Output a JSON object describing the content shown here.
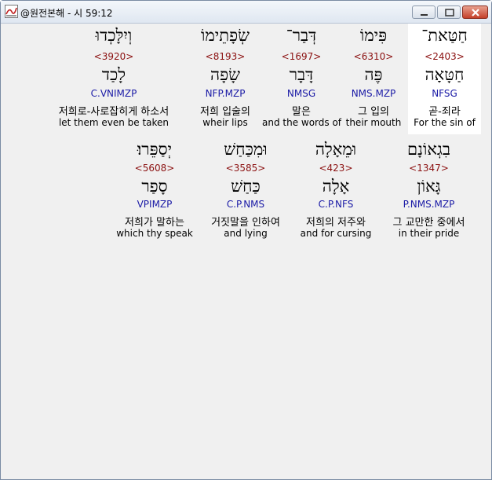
{
  "window": {
    "title": "@원전본해 - 시 59:12",
    "controls": {
      "minimize": "minimize",
      "maximize": "maximize",
      "close": "close"
    }
  },
  "rows": [
    {
      "words": [
        {
          "hebrew": "חַטַּאת־",
          "strong": "<2403>",
          "lemma": "חַטָּאָה",
          "parse": "NFSG",
          "korean": "곧-죄라",
          "english": "For the sin of",
          "selected": true
        },
        {
          "hebrew": "פִּימוֹ",
          "strong": "<6310>",
          "lemma": "פֶּה",
          "parse": "NMS.MZP",
          "korean": "그 입의",
          "english": "their mouth"
        },
        {
          "hebrew": "דְּבַר־",
          "strong": "<1697>",
          "lemma": "דָּבָר",
          "parse": "NMSG",
          "korean": "말은",
          "english": "and the words of"
        },
        {
          "hebrew": "שְׂפָתֵימוֹ",
          "strong": "<8193>",
          "lemma": "שָׂפָה",
          "parse": "NFP.MZP",
          "korean": "저희 입술의",
          "english": "wheir lips"
        },
        {
          "hebrew": "וְיִלָּכְדוּ",
          "strong": "<3920>",
          "lemma": "לָכַד",
          "parse": "C.VNIMZP",
          "korean": "저희로-사로잡히게 하소서",
          "english": "let them even be taken"
        }
      ]
    },
    {
      "words": [
        {
          "hebrew": "בִגְאוֹנָם",
          "strong": "<1347>",
          "lemma": "גָּאוֹן",
          "parse": "P.NMS.MZP",
          "korean": "그 교만한 중에서",
          "english": "in their pride"
        },
        {
          "hebrew": "וּמֵאָלָה",
          "strong": "<423>",
          "lemma": "אָלָה",
          "parse": "C.P.NFS",
          "korean": "저희의 저주와",
          "english": "and for cursing"
        },
        {
          "hebrew": "וּמִכַּחַשׁ",
          "strong": "<3585>",
          "lemma": "כַּחַשׁ",
          "parse": "C.P.NMS",
          "korean": "거짓말을 인하여",
          "english": "and lying"
        },
        {
          "hebrew": "יְסַפֵּרוּ׃",
          "strong": "<5608>",
          "lemma": "סָפַר",
          "parse": "VPIMZP",
          "korean": "저희가 말하는",
          "english": "which thy speak"
        }
      ]
    }
  ]
}
